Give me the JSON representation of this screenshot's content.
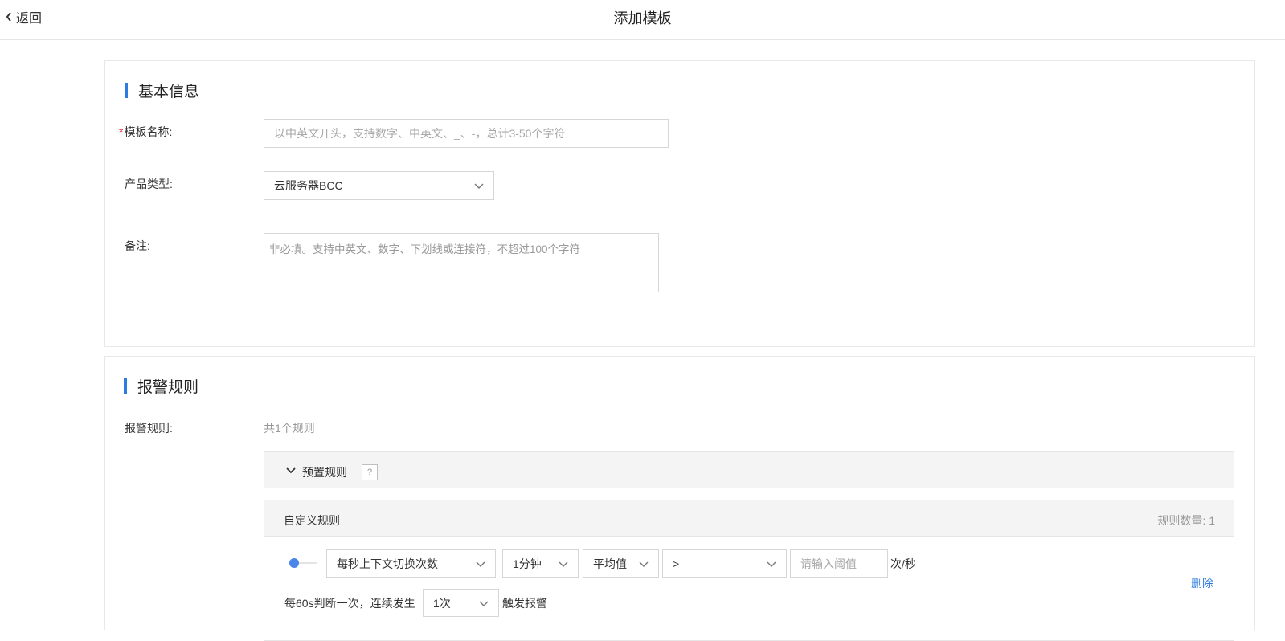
{
  "header": {
    "back_label": "返回",
    "title": "添加模板"
  },
  "basic": {
    "section_title": "基本信息",
    "name_required": "*",
    "name_label": "模板名称:",
    "name_placeholder": "以中英文开头，支持数字、中英文、_、-，总计3-50个字符",
    "product_label": "产品类型:",
    "product_value": "云服务器BCC",
    "remark_label": "备注:",
    "remark_placeholder": "非必填。支持中英文、数字、下划线或连接符，不超过100个字符"
  },
  "alarm": {
    "section_title": "报警规则",
    "rules_label": "报警规则:",
    "rules_count_text": "共1个规则",
    "preset_label": "预置规则",
    "help_mark": "?",
    "custom_label": "自定义规则",
    "rule_count_text": "规则数量: 1",
    "rule": {
      "metric": "每秒上下文切换次数",
      "period": "1分钟",
      "stat": "平均值",
      "operator": ">",
      "threshold_placeholder": "请输入阈值",
      "unit": "次/秒",
      "delete_label": "删除",
      "judge_prefix": "每60s判断一次，连续发生",
      "times": "1次",
      "trigger_suffix": "触发报警"
    }
  },
  "colors": {
    "accent": "#2d7ce0",
    "required": "#e8343c"
  }
}
